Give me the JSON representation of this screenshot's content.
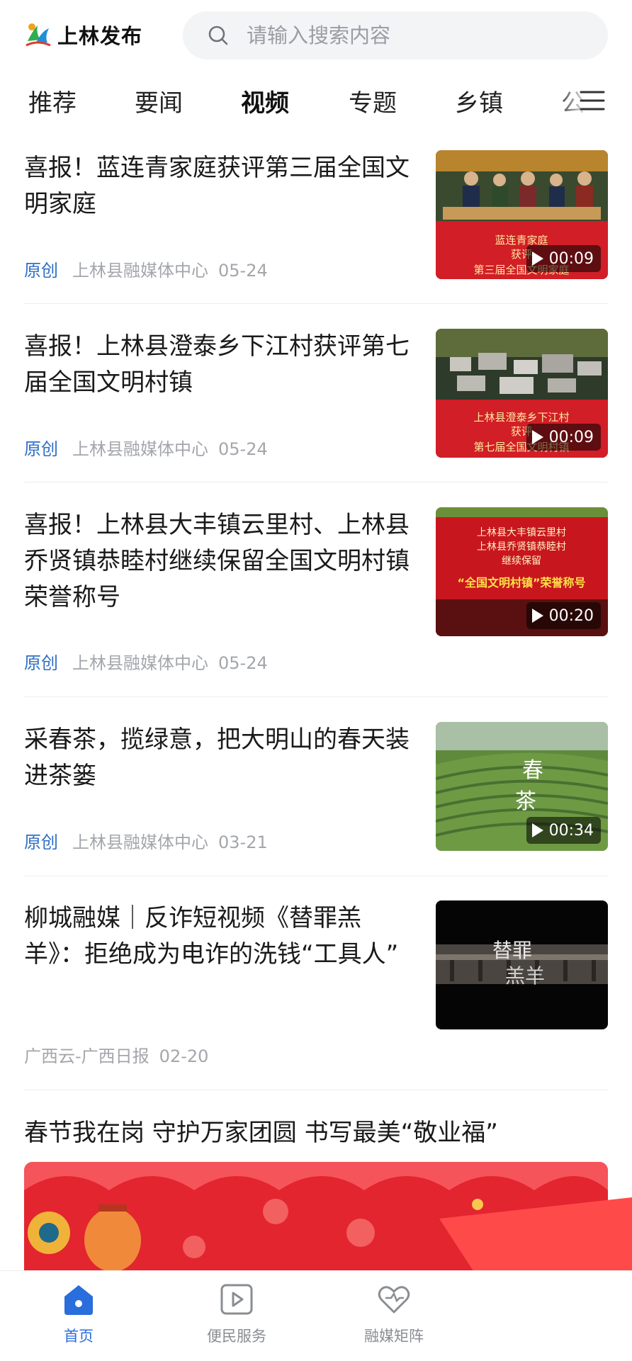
{
  "header": {
    "app_name": "上林发布",
    "search_placeholder": "请输入搜索内容"
  },
  "tabs": [
    {
      "label": "推荐",
      "active": false
    },
    {
      "label": "要闻",
      "active": false
    },
    {
      "label": "视频",
      "active": true
    },
    {
      "label": "专题",
      "active": false
    },
    {
      "label": "乡镇",
      "active": false
    },
    {
      "label": "公",
      "active": false
    }
  ],
  "news": [
    {
      "title": "喜报！蓝连青家庭获评第三届全国文明家庭",
      "original": "原创",
      "source": "上林县融媒体中心",
      "date": "05-24",
      "thumb_caption_1": "蓝连青家庭",
      "thumb_caption_2": "获评",
      "thumb_caption_3": "第三届全国文明家庭",
      "duration": "00:09"
    },
    {
      "title": "喜报！上林县澄泰乡下江村获评第七届全国文明村镇",
      "original": "原创",
      "source": "上林县融媒体中心",
      "date": "05-24",
      "thumb_caption_1": "上林县澄泰乡下江村",
      "thumb_caption_2": "获评",
      "thumb_caption_3": "第七届全国文明村镇",
      "duration": "00:09"
    },
    {
      "title": "喜报！上林县大丰镇云里村、上林县乔贤镇恭睦村继续保留全国文明村镇荣誉称号",
      "original": "原创",
      "source": "上林县融媒体中心",
      "date": "05-24",
      "thumb_caption_1": "上林县大丰镇云里村",
      "thumb_caption_2": "上林县乔贤镇恭睦村",
      "thumb_caption_3": "继续保留",
      "thumb_caption_4": "“全国文明村镇”荣誉称号",
      "duration": "00:20"
    },
    {
      "title": "采春茶，揽绿意，把大明山的春天装进茶篓",
      "original": "原创",
      "source": "上林县融媒体中心",
      "date": "03-21",
      "thumb_caption_1": "春",
      "thumb_caption_2": "茶",
      "duration": "00:34"
    },
    {
      "title": "柳城融媒｜反诈短视频《替罪羔羊》：拒绝成为电诈的洗钱“工具人”",
      "source": "广西云-广西日报",
      "date": "02-20",
      "thumb_caption_1": "替罪",
      "thumb_caption_2": "羔羊"
    },
    {
      "title": "春节我在岗 守护万家团圆 书写最美“敬业福”"
    }
  ],
  "bottom_nav": [
    {
      "label": "首页",
      "icon": "home-icon",
      "active": true
    },
    {
      "label": "便民服务",
      "icon": "play-square-icon",
      "active": false
    },
    {
      "label": "融媒矩阵",
      "icon": "heart-icon",
      "active": false
    }
  ],
  "colors": {
    "accent": "#2a6ddc",
    "original_tag": "#2f6fc6",
    "meta_gray": "#a3a6ab",
    "banner_red": "#e3252f"
  }
}
